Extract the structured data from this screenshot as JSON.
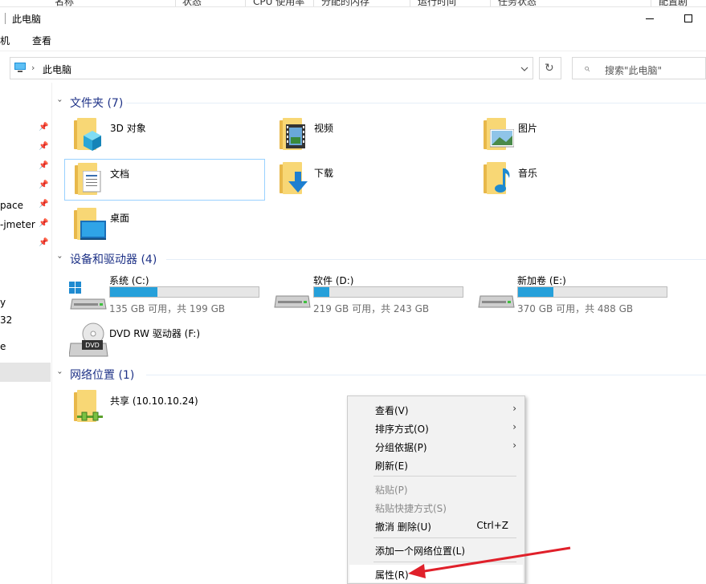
{
  "taskmgr_header": [
    "名称",
    "状态",
    "CPU 使用率",
    "分配的内存",
    "运行时间",
    "任务状态",
    "配置剧"
  ],
  "window": {
    "title": "此电脑"
  },
  "ribbon": {
    "tab_file": "机",
    "tab_view": "查看"
  },
  "address": {
    "path": "此电脑",
    "search_placeholder": "搜索\"此电脑\""
  },
  "nav": {
    "items": [
      "pace",
      "-jmeter",
      "y",
      "32",
      "e"
    ]
  },
  "groups": {
    "folders": {
      "title": "文件夹 (7)",
      "items": [
        "3D 对象",
        "视频",
        "图片",
        "文档",
        "下载",
        "音乐",
        "桌面"
      ]
    },
    "drives": {
      "title": "设备和驱动器 (4)",
      "items": [
        {
          "name": "系统 (C:)",
          "free": "135 GB 可用，共 199 GB",
          "used_fraction": 0.32
        },
        {
          "name": "软件 (D:)",
          "free": "219 GB 可用，共 243 GB",
          "used_fraction": 0.1
        },
        {
          "name": "新加卷 (E:)",
          "free": "370 GB 可用，共 488 GB",
          "used_fraction": 0.24
        }
      ],
      "dvd": {
        "name": "DVD RW 驱动器 (F:)",
        "badge": "DVD"
      }
    },
    "network": {
      "title": "网络位置 (1)",
      "items": [
        "共享 (10.10.10.24)"
      ]
    }
  },
  "context_menu": {
    "view": "查看(V)",
    "sort": "排序方式(O)",
    "group": "分组依据(P)",
    "refresh": "刷新(E)",
    "paste": "粘贴(P)",
    "paste_shortcut": "粘贴快捷方式(S)",
    "undo": "撤消 删除(U)",
    "undo_shortcut": "Ctrl+Z",
    "add_network": "添加一个网络位置(L)",
    "properties": "属性(R)"
  },
  "colors": {
    "accent": "#26a0da",
    "group_title": "#1e3287",
    "annotation_arrow": "#e0202a"
  }
}
